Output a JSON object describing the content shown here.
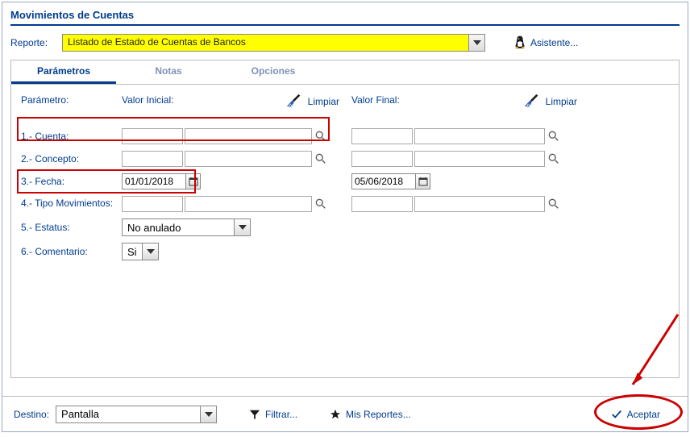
{
  "window": {
    "title": "Movimientos de Cuentas"
  },
  "report": {
    "label": "Reporte:",
    "value": "Listado de Estado de Cuentas de Bancos"
  },
  "assistant": {
    "label": "Asistente..."
  },
  "tabs": {
    "parametros": "Parámetros",
    "notas": "Notas",
    "opciones": "Opciones"
  },
  "headers": {
    "parametro": "Parámetro:",
    "valor_inicial": "Valor Inicial:",
    "limpiar": "Limpiar",
    "valor_final": "Valor Final:"
  },
  "params": {
    "p1": {
      "label": "1.- Cuenta:"
    },
    "p2": {
      "label": "2.- Concepto:"
    },
    "p3": {
      "label": "3.- Fecha:",
      "inicial": "01/01/2018",
      "final": "05/06/2018"
    },
    "p4": {
      "label": "4.- Tipo Movimientos:"
    },
    "p5": {
      "label": "5.- Estatus:",
      "value": "No anulado"
    },
    "p6": {
      "label": "6.- Comentario:",
      "value": "Si"
    }
  },
  "bottom": {
    "destino_label": "Destino:",
    "destino_value": "Pantalla",
    "filtrar": "Filtrar...",
    "mis_reportes": "Mis Reportes...",
    "aceptar": "Aceptar"
  }
}
